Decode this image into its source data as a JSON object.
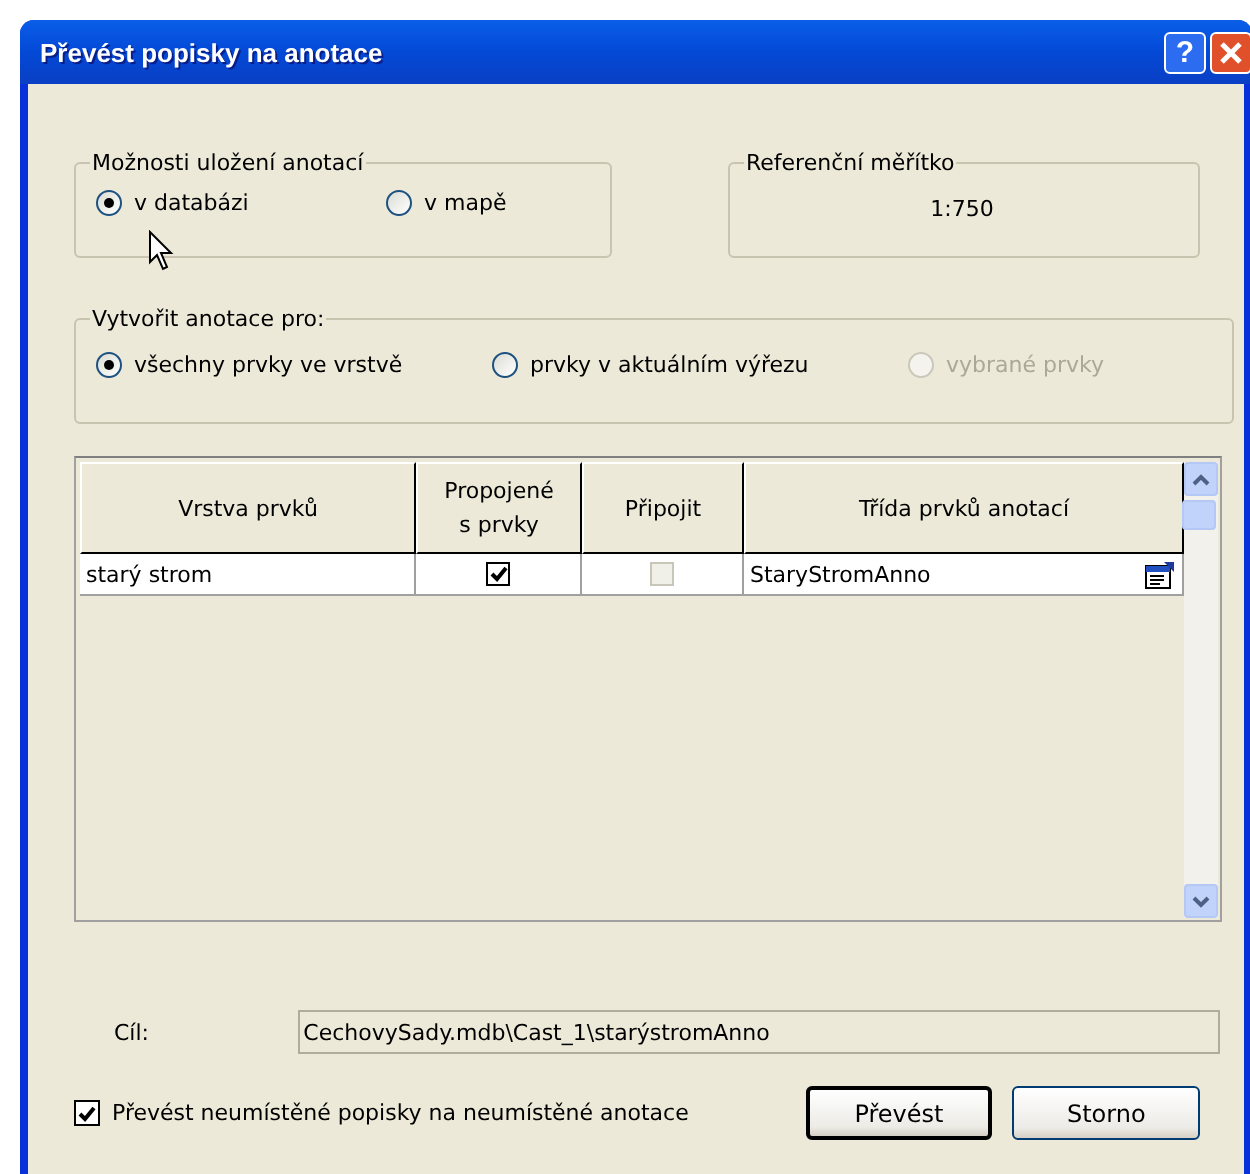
{
  "window": {
    "title": "Převést popisky na anotace",
    "help": "?"
  },
  "storage": {
    "title": "Možnosti uložení anotací",
    "options": [
      {
        "label": "v databázi",
        "selected": true
      },
      {
        "label": "v mapě",
        "selected": false
      }
    ]
  },
  "reference_scale": {
    "title": "Referenční měřítko",
    "value": "1:750"
  },
  "create_for": {
    "title": "Vytvořit anotace pro:",
    "options": [
      {
        "label": "všechny prvky ve vrstvě",
        "selected": true,
        "disabled": false
      },
      {
        "label": "prvky v aktuálním výřezu",
        "selected": false,
        "disabled": false
      },
      {
        "label": "vybrané prvky",
        "selected": false,
        "disabled": true
      }
    ]
  },
  "table": {
    "columns": [
      "Vrstva prvků",
      "Propojené s prvky",
      "Připojit",
      "Třída prvků anotací"
    ],
    "rows": [
      {
        "layer": "starý strom",
        "linked": {
          "checked": true,
          "disabled": false
        },
        "append": {
          "checked": false,
          "disabled": true
        },
        "class": "StaryStromAnno"
      }
    ]
  },
  "target": {
    "label": "Cíl:",
    "value": "CechovySady.mdb\\Cast_1\\starýstromAnno"
  },
  "convert_unplaced": {
    "label": "Převést neumístěné popisky na neumístěné anotace",
    "checked": true
  },
  "buttons": [
    {
      "label": "Převést",
      "default": true
    },
    {
      "label": "Storno",
      "default": false
    }
  ]
}
